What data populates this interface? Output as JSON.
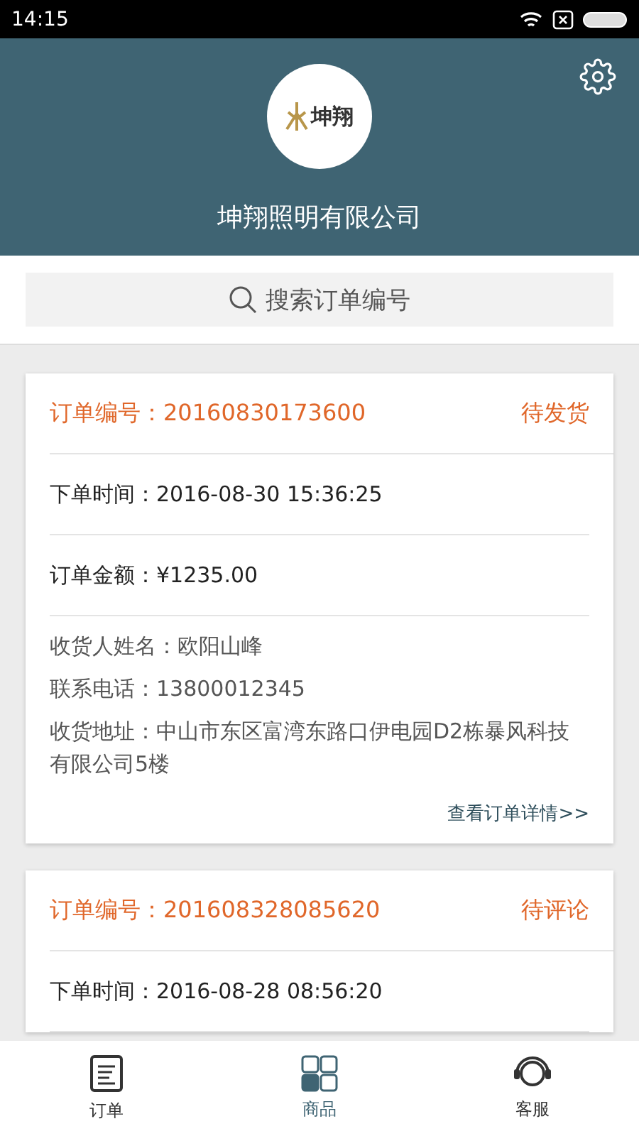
{
  "status_bar": {
    "time": "14:15"
  },
  "header": {
    "logo_text": "坤翔",
    "company": "坤翔照明有限公司"
  },
  "search": {
    "placeholder": "搜索订单编号"
  },
  "orders": [
    {
      "order_label": "订单编号：",
      "order_no": "20160830173600",
      "status": "待发货",
      "rows": [
        {
          "kind": "main",
          "text": "下单时间：2016-08-30  15:36:25"
        },
        {
          "kind": "main",
          "text": "订单金额：¥1235.00"
        },
        {
          "kind": "detail",
          "text": "收货人姓名：欧阳山峰"
        },
        {
          "kind": "detail",
          "text": "联系电话：13800012345"
        },
        {
          "kind": "detail",
          "text": "收货地址：中山市东区富湾东路口伊电园D2栋暴风科技有限公司5楼"
        }
      ],
      "link": "查看订单详情>>"
    },
    {
      "order_label": "订单编号：",
      "order_no": "201608328085620",
      "status": "待评论",
      "rows": [
        {
          "kind": "main",
          "text": "下单时间：2016-08-28  08:56:20"
        }
      ]
    }
  ],
  "tabs": [
    {
      "kind": "orders",
      "label": "订单",
      "selected": false
    },
    {
      "kind": "products",
      "label": "商品",
      "selected": true
    },
    {
      "kind": "service",
      "label": "客服",
      "selected": false
    }
  ]
}
